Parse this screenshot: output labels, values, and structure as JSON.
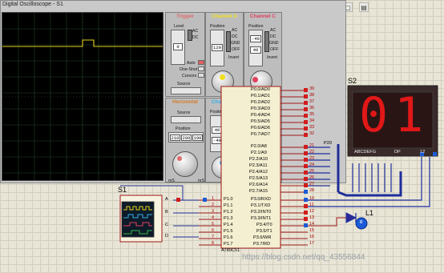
{
  "window": {
    "title": "Digital Oscilloscope - S1"
  },
  "toolbar": {
    "icons": [
      "up-arrow",
      "hand",
      "text-T",
      "text-T2",
      "text-A",
      "grid",
      "frame",
      "page"
    ]
  },
  "channels": {
    "trigger": {
      "title": "Trigger",
      "color": "#e06b6b",
      "level_label": "Level",
      "level_value": "0",
      "ac": "AC",
      "dc": "DC",
      "auto": "Auto",
      "one_shot": "One-Shot",
      "cursors": "Cursors",
      "source": "Source"
    },
    "a": {
      "title": "Channel A",
      "color": "#f0e020",
      "position_label": "Position",
      "position_value": "120",
      "ac": "AC",
      "dc": "DC",
      "gnd": "GND",
      "off": "OFF",
      "invert": "Invert",
      "mv": "mV"
    },
    "c": {
      "title": "Channel C",
      "color": "#e04060",
      "position_label": "Position",
      "position_value": "-40",
      "position_value2": "40",
      "ac": "AC",
      "dc": "DC",
      "gnd": "GND",
      "off": "OFF",
      "invert": "Invert",
      "mv": "mV"
    },
    "horizontal": {
      "title": "Horizontal",
      "color": "#d77a2a",
      "source": "Source",
      "position_label": "Position",
      "pos_values": [
        "210",
        "200",
        "190"
      ],
      "mS": "mS",
      "ms2": "mS"
    },
    "b": {
      "title": "Channel B",
      "color": "#35aee8",
      "position_label": "Position",
      "position_value": "40",
      "position_value2": "-40",
      "ac": "AC",
      "dc": "DC",
      "gnd": "GND",
      "off": "OFF",
      "invert": "Invert",
      "mv": "mV"
    },
    "d": {
      "title": "Channel D",
      "color": "#34b64a",
      "position_label": "Position",
      "position_value": "-120",
      "position_value2": "120",
      "ac": "AC",
      "dc": "DC",
      "gnd": "GND",
      "off": "OFF",
      "invert": "Invert",
      "mv": "mV"
    }
  },
  "mcu": {
    "name": "AT89C51",
    "p0": [
      {
        "num": "39",
        "label": "P0.0/AD0"
      },
      {
        "num": "38",
        "label": "P0.1/AD1"
      },
      {
        "num": "37",
        "label": "P0.2/AD2"
      },
      {
        "num": "36",
        "label": "P0.3/AD3"
      },
      {
        "num": "35",
        "label": "P0.4/AD4"
      },
      {
        "num": "34",
        "label": "P0.5/AD5"
      },
      {
        "num": "33",
        "label": "P0.6/AD6"
      },
      {
        "num": "32",
        "label": "P0.7/AD7"
      }
    ],
    "p2": [
      {
        "num": "21",
        "label": "P2.0/A8"
      },
      {
        "num": "22",
        "label": "P2.1/A9"
      },
      {
        "num": "23",
        "label": "P2.2/A10"
      },
      {
        "num": "24",
        "label": "P2.3/A11"
      },
      {
        "num": "25",
        "label": "P2.4/A12"
      },
      {
        "num": "26",
        "label": "P2.5/A13"
      },
      {
        "num": "27",
        "label": "P2.6/A14"
      },
      {
        "num": "28",
        "label": "P2.7/A15"
      }
    ],
    "p3": [
      {
        "num": "10",
        "label": "P3.0/RXD"
      },
      {
        "num": "11",
        "label": "P3.1/TXD"
      },
      {
        "num": "12",
        "label": "P3.2/INT0"
      },
      {
        "num": "13",
        "label": "P3.3/INT1"
      },
      {
        "num": "14",
        "label": "P3.4/T0"
      },
      {
        "num": "15",
        "label": "P3.5/T1"
      },
      {
        "num": "16",
        "label": "P3.6/WR"
      },
      {
        "num": "17",
        "label": "P3.7/RD"
      }
    ],
    "p1": [
      {
        "num": "1",
        "label": "P1.0"
      },
      {
        "num": "2",
        "label": "P1.1"
      },
      {
        "num": "3",
        "label": "P1.2"
      },
      {
        "num": "4",
        "label": "P1.3"
      },
      {
        "num": "5",
        "label": "P1.4"
      },
      {
        "num": "6",
        "label": "P1.5"
      },
      {
        "num": "7",
        "label": "P1.6"
      },
      {
        "num": "8",
        "label": "P1.7"
      }
    ]
  },
  "display": {
    "ref": "S2",
    "digits": "01",
    "seg_label": "ABCDEFG",
    "dp_label": "DP",
    "pin_label": "12",
    "bus_label": "P20"
  },
  "scope_symbol": {
    "ref": "S1",
    "inputs": [
      "A",
      "B",
      "C",
      "D"
    ]
  },
  "led": {
    "ref": "L1",
    "value": "0"
  },
  "watermark": "https://blog.csdn.net/qq_43556844",
  "colors": {
    "trace": "#e6d21a",
    "grid": "#2a4a2a",
    "segment": "#e01818"
  }
}
